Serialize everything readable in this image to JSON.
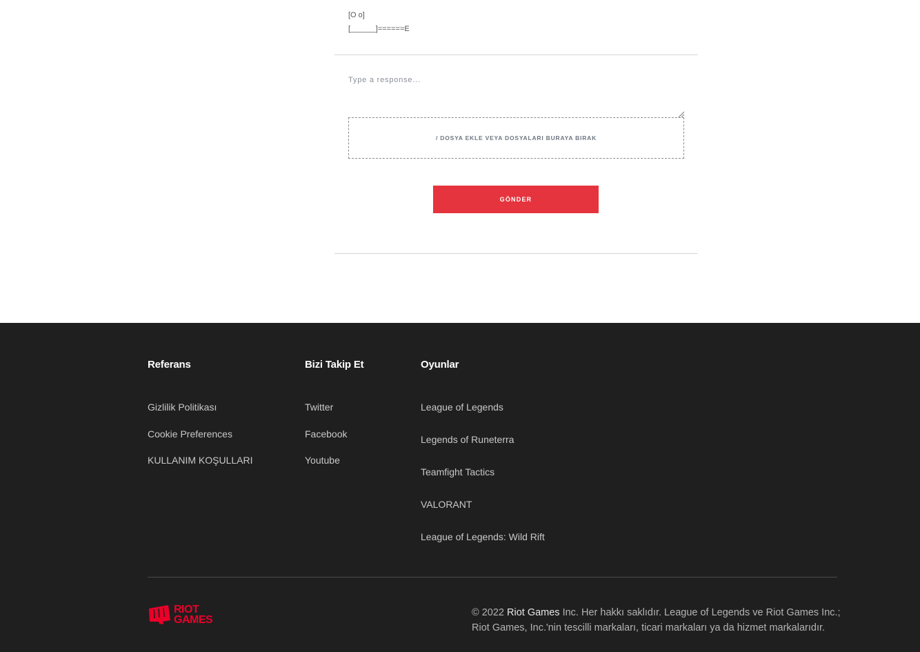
{
  "ascii_art": {
    "line1": "[O o]",
    "line2": "[______]======E"
  },
  "reply": {
    "placeholder": "Type a response...",
    "dropzone_label": "/ DOSYA EKLE VEYA DOSYALARI BURAYA BIRAK",
    "submit_label": "GÖNDER"
  },
  "footer": {
    "columns": [
      {
        "title": "Referans",
        "links": [
          "Gizlilik Politikası",
          "Cookie Preferences",
          "KULLANIM KOŞULLARI"
        ]
      },
      {
        "title": "Bizi Takip Et",
        "links": [
          "Twitter",
          "Facebook",
          "Youtube"
        ]
      },
      {
        "title": "Oyunlar",
        "links": [
          "League of Legends",
          "Legends of Runeterra",
          "Teamfight Tactics",
          "VALORANT",
          "League of Legends: Wild Rift"
        ]
      }
    ],
    "logo": {
      "line1": "RIOT",
      "line2": "GAMES",
      "color": "#eb0029"
    },
    "copyright": {
      "line1_prefix": "© 2022 ",
      "line1_brand": "Riot Games",
      "line1_suffix": " Inc. Her hakkı saklıdır. League of Legends ve Riot Games Inc.;",
      "line2": "Riot Games, Inc.'nin tescilli markaları, ticari markaları ya da hizmet markalarıdır."
    }
  },
  "colors": {
    "accent": "#e5343d",
    "footer_bg": "#1f1f1f"
  }
}
